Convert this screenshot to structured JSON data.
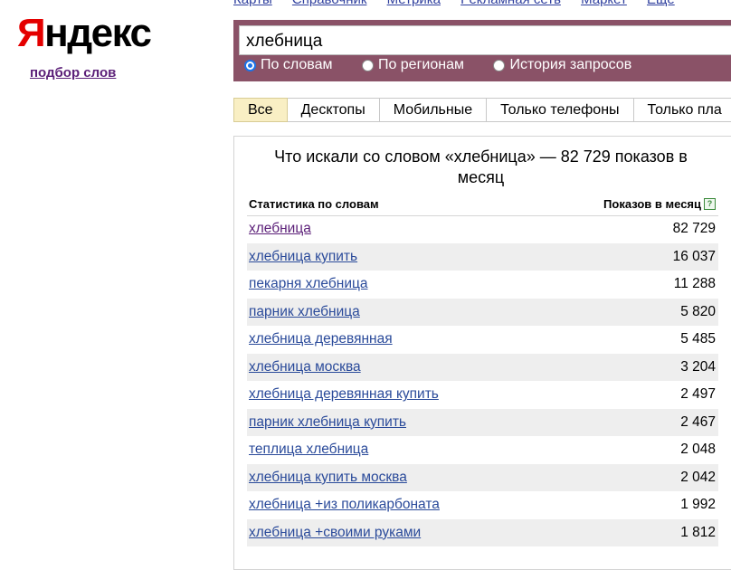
{
  "top_nav": [
    "Карты",
    "Справочник",
    "Метрика",
    "Рекламная сеть",
    "Маркет",
    "Ещё"
  ],
  "logo": {
    "y": "Я",
    "rest": "ндекс"
  },
  "tool_link": "подбор слов",
  "search": {
    "value": "хлебница"
  },
  "modes": [
    "По словам",
    "По регионам",
    "История запросов"
  ],
  "tabs": [
    "Все",
    "Десктопы",
    "Мобильные",
    "Только телефоны",
    "Только пла"
  ],
  "results": {
    "title": "Что искали со словом «хлебница» — 82 729 показов в месяц",
    "col_left": "Статистика по словам",
    "col_right": "Показов в месяц",
    "help_icon": "?",
    "rows": [
      {
        "keyword": "хлебница",
        "count": "82 729"
      },
      {
        "keyword": "хлебница купить",
        "count": "16 037"
      },
      {
        "keyword": "пекарня хлебница",
        "count": "11 288"
      },
      {
        "keyword": "парник хлебница",
        "count": "5 820"
      },
      {
        "keyword": "хлебница деревянная",
        "count": "5 485"
      },
      {
        "keyword": "хлебница москва",
        "count": "3 204"
      },
      {
        "keyword": "хлебница деревянная купить",
        "count": "2 497"
      },
      {
        "keyword": "парник хлебница купить",
        "count": "2 467"
      },
      {
        "keyword": "теплица хлебница",
        "count": "2 048"
      },
      {
        "keyword": "хлебница купить москва",
        "count": "2 042"
      },
      {
        "keyword": "хлебница +из поликарбоната",
        "count": "1 992"
      },
      {
        "keyword": "хлебница +своими руками",
        "count": "1 812"
      }
    ]
  }
}
